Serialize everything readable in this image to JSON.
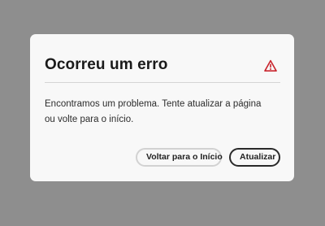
{
  "dialog": {
    "title": "Ocorreu um erro",
    "alert_icon": "alert-triangle-icon",
    "alert_color": "#c9252d",
    "message": "Encontramos um problema. Tente atualizar a página ou volte para o início.",
    "buttons": {
      "secondary_label": "Voltar para o Início",
      "primary_label": "Atualizar"
    }
  }
}
